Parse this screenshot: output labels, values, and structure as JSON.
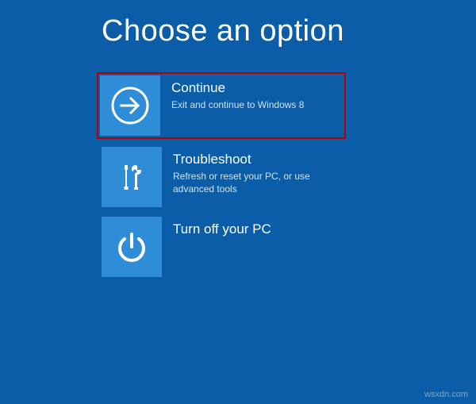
{
  "page": {
    "title": "Choose an option"
  },
  "options": [
    {
      "icon": "arrow-right-icon",
      "title": "Continue",
      "description": "Exit and continue to Windows 8",
      "highlighted": true
    },
    {
      "icon": "tools-icon",
      "title": "Troubleshoot",
      "description": "Refresh or reset your PC, or use advanced tools",
      "highlighted": false
    },
    {
      "icon": "power-icon",
      "title": "Turn off your PC",
      "description": "",
      "highlighted": false
    }
  ],
  "watermark": "wsxdn.com",
  "colors": {
    "background": "#0a5da6",
    "tile": "#2e8dd6",
    "highlight": "#b40000"
  }
}
